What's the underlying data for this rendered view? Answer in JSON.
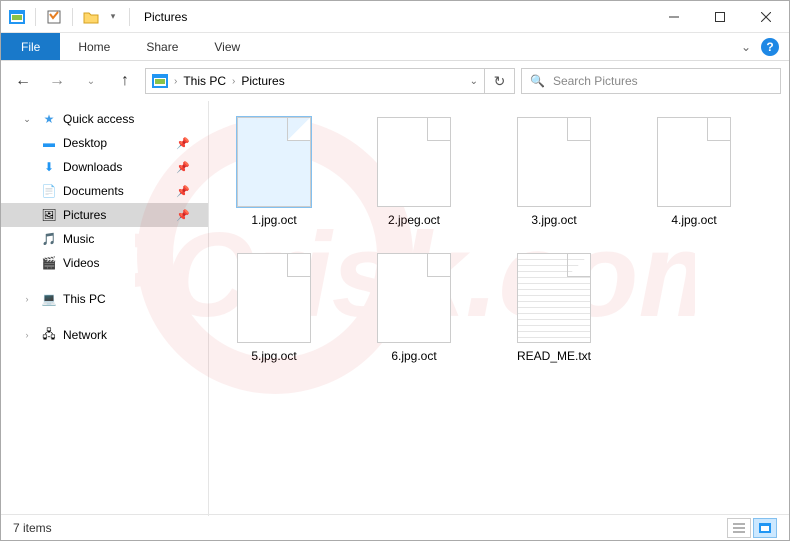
{
  "window": {
    "title": "Pictures"
  },
  "ribbon": {
    "file": "File",
    "tabs": [
      "Home",
      "Share",
      "View"
    ]
  },
  "breadcrumb": {
    "items": [
      "This PC",
      "Pictures"
    ]
  },
  "search": {
    "placeholder": "Search Pictures"
  },
  "sidebar": {
    "quick_access": "Quick access",
    "items": [
      {
        "label": "Desktop",
        "pinned": true
      },
      {
        "label": "Downloads",
        "pinned": true
      },
      {
        "label": "Documents",
        "pinned": true
      },
      {
        "label": "Pictures",
        "pinned": true,
        "selected": true
      },
      {
        "label": "Music",
        "pinned": false
      },
      {
        "label": "Videos",
        "pinned": false
      }
    ],
    "this_pc": "This PC",
    "network": "Network"
  },
  "files": [
    {
      "name": "1.jpg.oct",
      "type": "blank",
      "selected": true
    },
    {
      "name": "2.jpeg.oct",
      "type": "blank",
      "selected": false
    },
    {
      "name": "3.jpg.oct",
      "type": "blank",
      "selected": false
    },
    {
      "name": "4.jpg.oct",
      "type": "blank",
      "selected": false
    },
    {
      "name": "5.jpg.oct",
      "type": "blank",
      "selected": false
    },
    {
      "name": "6.jpg.oct",
      "type": "blank",
      "selected": false
    },
    {
      "name": "READ_ME.txt",
      "type": "txt",
      "selected": false
    }
  ],
  "status": {
    "count_label": "7 items"
  },
  "icons": {
    "star": "★",
    "desktop": "🖥",
    "downloads": "⬇",
    "documents": "📄",
    "pictures": "🖼",
    "music": "🎵",
    "videos": "🎬",
    "this_pc": "💻",
    "network": "🖧",
    "search": "🔍",
    "refresh": "↻",
    "chevron": "›",
    "dropdown": "⌄",
    "up": "↑",
    "back": "←",
    "forward": "→",
    "help": "?",
    "folder": "📁",
    "check": "✓"
  }
}
